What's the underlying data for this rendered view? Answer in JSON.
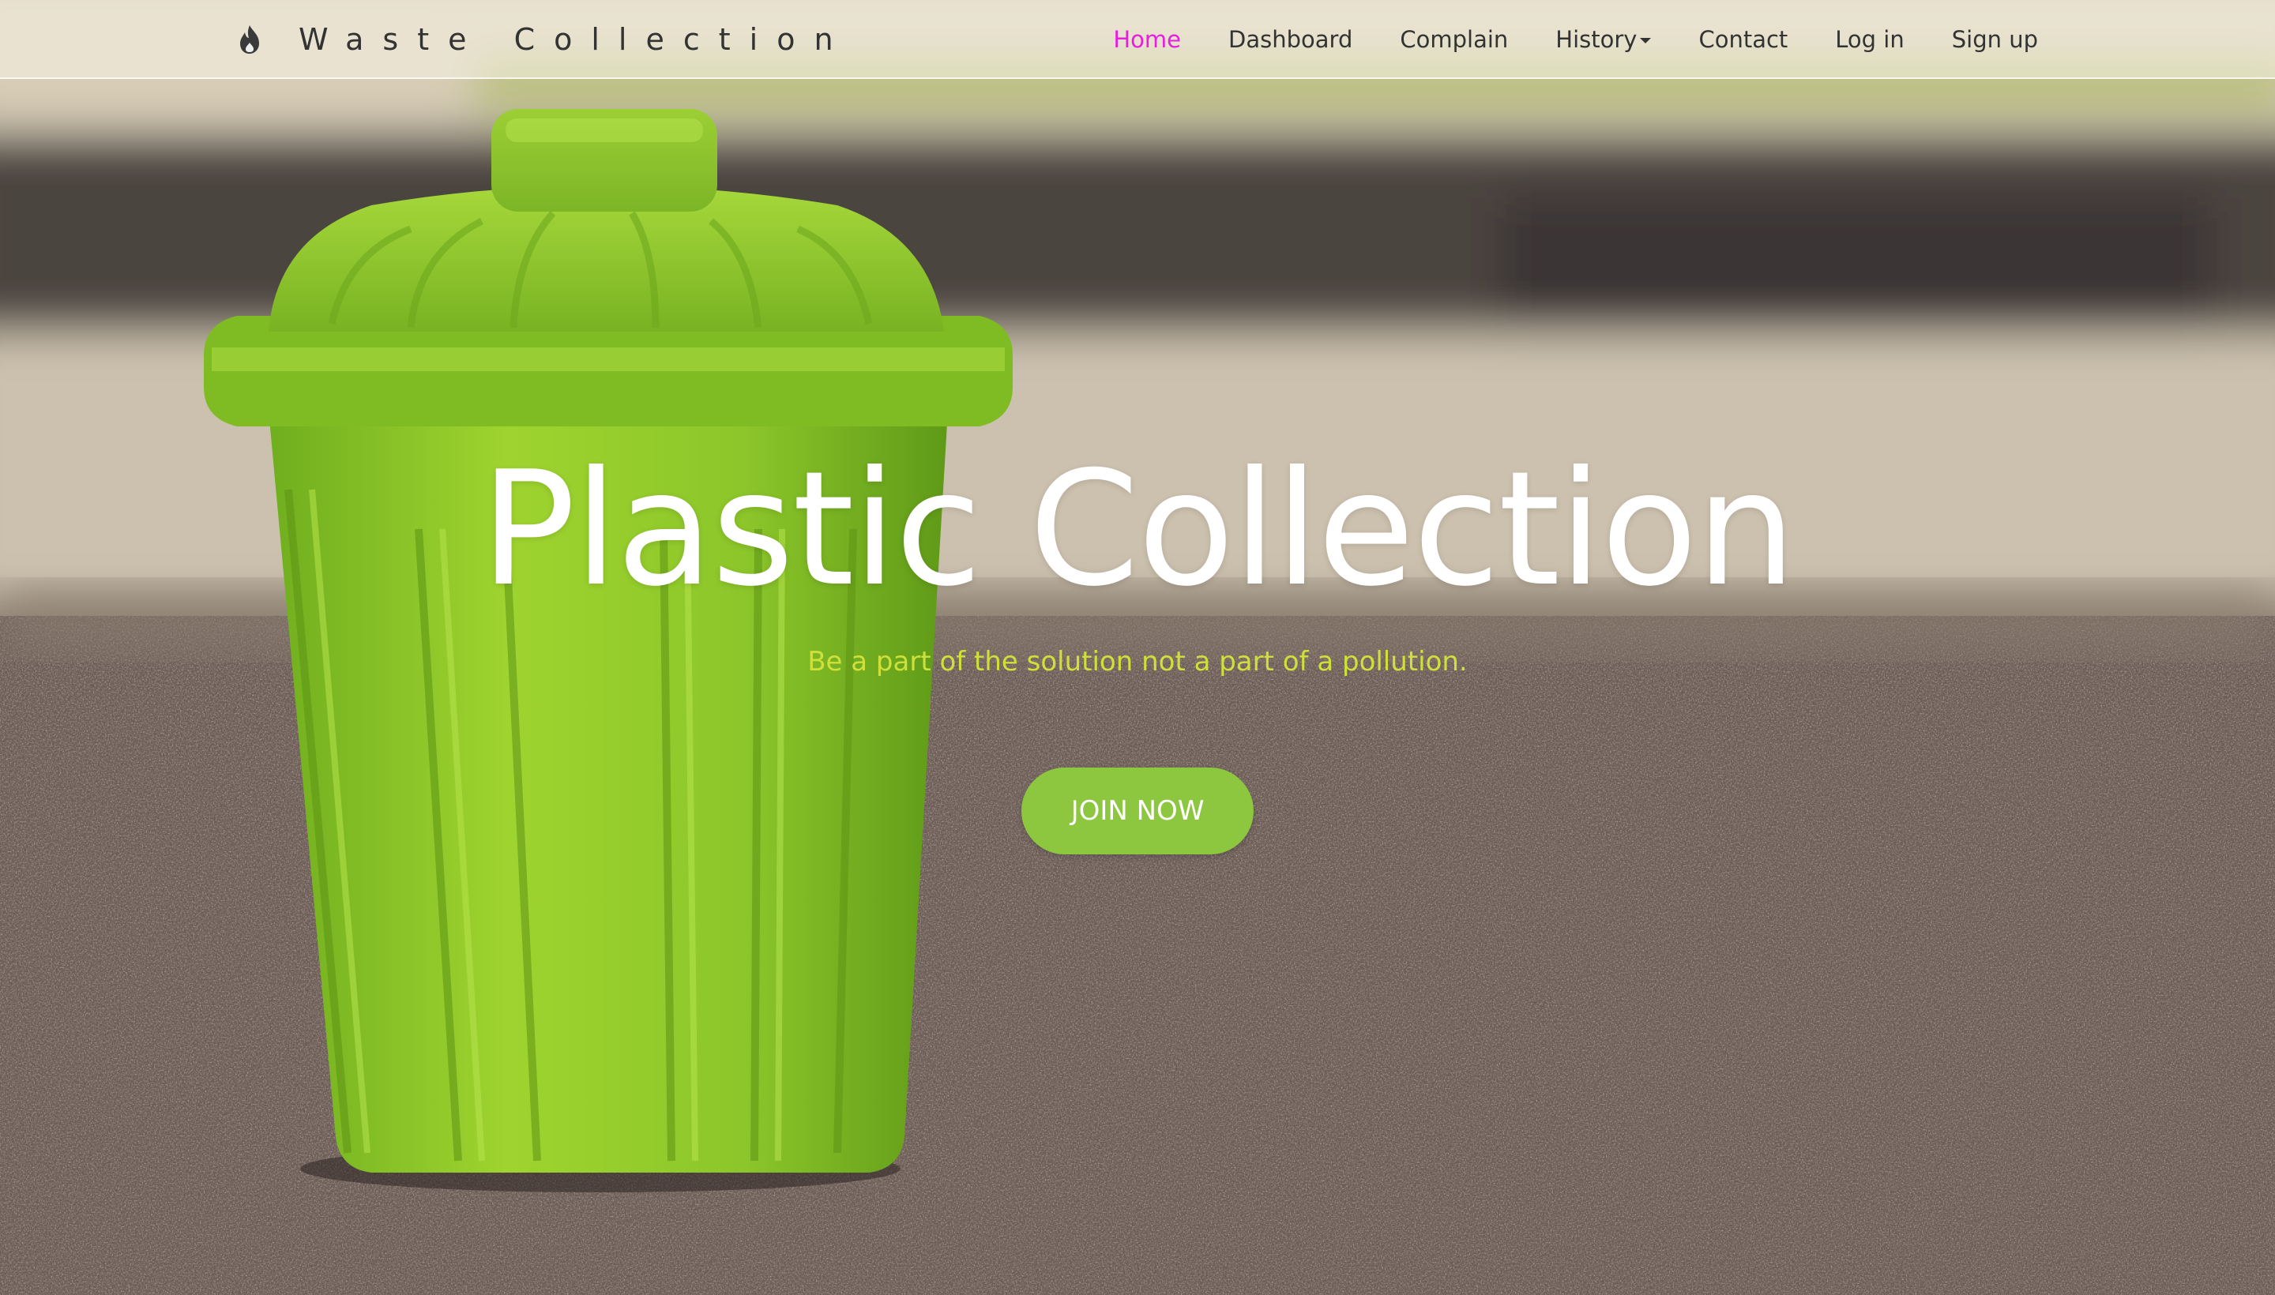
{
  "brand": {
    "icon": "flame-icon",
    "title": "Waste Collection"
  },
  "nav": {
    "items": [
      {
        "label": "Home",
        "active": true
      },
      {
        "label": "Dashboard",
        "active": false
      },
      {
        "label": "Complain",
        "active": false
      },
      {
        "label": "History",
        "active": false,
        "dropdown": true
      },
      {
        "label": "Contact",
        "active": false
      },
      {
        "label": "Log in",
        "active": false
      },
      {
        "label": "Sign up",
        "active": false
      }
    ],
    "active_color": "#e81de0"
  },
  "hero": {
    "title": "Plastic Collection",
    "subtitle": "Be a part of the solution not a part of a pollution.",
    "cta_label": "JOIN NOW",
    "cta_color": "#8dc63f",
    "subtitle_color": "#cfe03a",
    "background": "green-trash-bin-photo"
  }
}
